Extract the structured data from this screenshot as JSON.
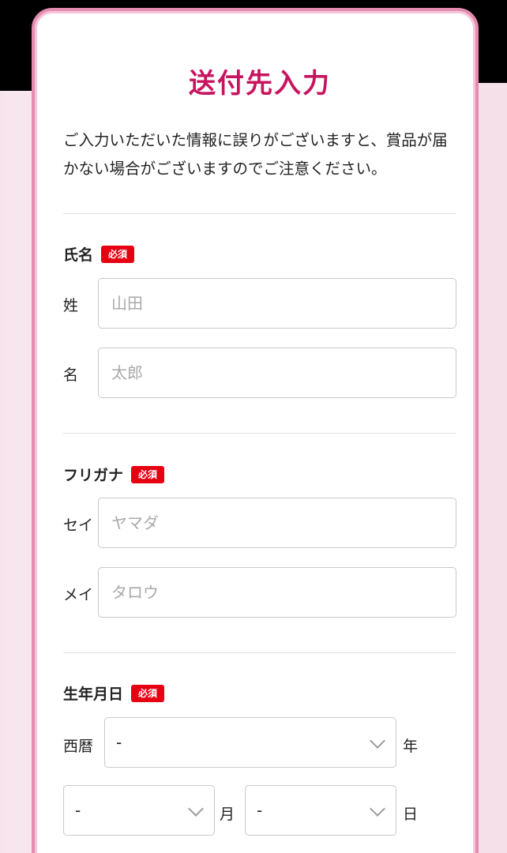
{
  "form": {
    "title": "送付先入力",
    "notice": "ご入力いただいた情報に誤りがございますと、賞品が届かない場合がございますのでご注意ください。",
    "required_label": "必須",
    "name": {
      "label": "氏名",
      "last_label": "姓",
      "last_placeholder": "山田",
      "first_label": "名",
      "first_placeholder": "太郎"
    },
    "furigana": {
      "label": "フリガナ",
      "last_label": "セイ",
      "last_placeholder": "ヤマダ",
      "first_label": "メイ",
      "first_placeholder": "タロウ"
    },
    "birthdate": {
      "label": "生年月日",
      "era_label": "西暦",
      "year_value": "-",
      "year_unit": "年",
      "month_value": "-",
      "month_unit": "月",
      "day_value": "-",
      "day_unit": "日"
    }
  },
  "colors": {
    "title": "#c8145f",
    "required_badge": "#e60012",
    "card_border": "#e58db0",
    "page_background": "#f6e3ec"
  },
  "icons": {
    "select_arrow": "chevron-down-icon"
  }
}
